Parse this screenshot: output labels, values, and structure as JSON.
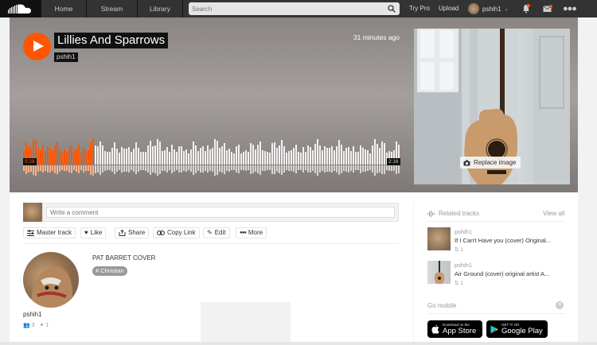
{
  "nav": {
    "logo_icon": "soundcloud-cloud-icon",
    "home": "Home",
    "stream": "Stream",
    "library": "Library",
    "search_placeholder": "Search",
    "try_pro": "Try Pro",
    "upload": "Upload",
    "username": "pshih1"
  },
  "track": {
    "title": "Lillies And Sparrows",
    "artist": "pshih1",
    "time_ago": "31 minutes ago",
    "time_current": "0:28",
    "time_total": "2:16",
    "progress_fraction": 0.19,
    "replace_image": "Replace image"
  },
  "comment": {
    "placeholder": "Write a comment"
  },
  "actions": {
    "master": "Master track",
    "like": "Like",
    "share": "Share",
    "copy_link": "Copy Link",
    "edit": "Edit",
    "more": "More"
  },
  "uploader": {
    "name": "pshih1",
    "followers": "3",
    "following": "1"
  },
  "description": "PAT BARRET COVER",
  "tag": "# Christian",
  "sidebar": {
    "related_title": "Related tracks",
    "view_all": "View all",
    "related": [
      {
        "artist": "pshih1",
        "title": "If I Can't Have you (cover) Original...",
        "reposts": "1"
      },
      {
        "artist": "pshih1",
        "title": "Air Ground (cover) original artist A...",
        "reposts": "1"
      }
    ],
    "go_mobile": "Go mobile",
    "app_store_small": "Download on the",
    "app_store": "App Store",
    "google_play_small": "GET IT ON",
    "google_play": "Google Play"
  },
  "colors": {
    "accent": "#ff5500",
    "nav_bg": "#333333"
  }
}
